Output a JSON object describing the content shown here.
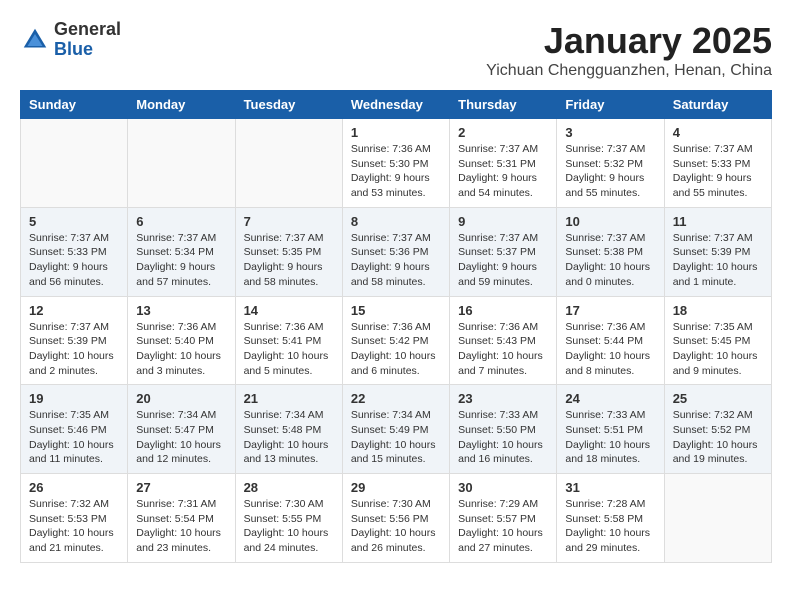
{
  "header": {
    "logo_general": "General",
    "logo_blue": "Blue",
    "month_title": "January 2025",
    "location": "Yichuan Chengguanzhen, Henan, China"
  },
  "weekdays": [
    "Sunday",
    "Monday",
    "Tuesday",
    "Wednesday",
    "Thursday",
    "Friday",
    "Saturday"
  ],
  "weeks": [
    [
      {
        "day": "",
        "sunrise": "",
        "sunset": "",
        "daylight": ""
      },
      {
        "day": "",
        "sunrise": "",
        "sunset": "",
        "daylight": ""
      },
      {
        "day": "",
        "sunrise": "",
        "sunset": "",
        "daylight": ""
      },
      {
        "day": "1",
        "sunrise": "Sunrise: 7:36 AM",
        "sunset": "Sunset: 5:30 PM",
        "daylight": "Daylight: 9 hours and 53 minutes."
      },
      {
        "day": "2",
        "sunrise": "Sunrise: 7:37 AM",
        "sunset": "Sunset: 5:31 PM",
        "daylight": "Daylight: 9 hours and 54 minutes."
      },
      {
        "day": "3",
        "sunrise": "Sunrise: 7:37 AM",
        "sunset": "Sunset: 5:32 PM",
        "daylight": "Daylight: 9 hours and 55 minutes."
      },
      {
        "day": "4",
        "sunrise": "Sunrise: 7:37 AM",
        "sunset": "Sunset: 5:33 PM",
        "daylight": "Daylight: 9 hours and 55 minutes."
      }
    ],
    [
      {
        "day": "5",
        "sunrise": "Sunrise: 7:37 AM",
        "sunset": "Sunset: 5:33 PM",
        "daylight": "Daylight: 9 hours and 56 minutes."
      },
      {
        "day": "6",
        "sunrise": "Sunrise: 7:37 AM",
        "sunset": "Sunset: 5:34 PM",
        "daylight": "Daylight: 9 hours and 57 minutes."
      },
      {
        "day": "7",
        "sunrise": "Sunrise: 7:37 AM",
        "sunset": "Sunset: 5:35 PM",
        "daylight": "Daylight: 9 hours and 58 minutes."
      },
      {
        "day": "8",
        "sunrise": "Sunrise: 7:37 AM",
        "sunset": "Sunset: 5:36 PM",
        "daylight": "Daylight: 9 hours and 58 minutes."
      },
      {
        "day": "9",
        "sunrise": "Sunrise: 7:37 AM",
        "sunset": "Sunset: 5:37 PM",
        "daylight": "Daylight: 9 hours and 59 minutes."
      },
      {
        "day": "10",
        "sunrise": "Sunrise: 7:37 AM",
        "sunset": "Sunset: 5:38 PM",
        "daylight": "Daylight: 10 hours and 0 minutes."
      },
      {
        "day": "11",
        "sunrise": "Sunrise: 7:37 AM",
        "sunset": "Sunset: 5:39 PM",
        "daylight": "Daylight: 10 hours and 1 minute."
      }
    ],
    [
      {
        "day": "12",
        "sunrise": "Sunrise: 7:37 AM",
        "sunset": "Sunset: 5:39 PM",
        "daylight": "Daylight: 10 hours and 2 minutes."
      },
      {
        "day": "13",
        "sunrise": "Sunrise: 7:36 AM",
        "sunset": "Sunset: 5:40 PM",
        "daylight": "Daylight: 10 hours and 3 minutes."
      },
      {
        "day": "14",
        "sunrise": "Sunrise: 7:36 AM",
        "sunset": "Sunset: 5:41 PM",
        "daylight": "Daylight: 10 hours and 5 minutes."
      },
      {
        "day": "15",
        "sunrise": "Sunrise: 7:36 AM",
        "sunset": "Sunset: 5:42 PM",
        "daylight": "Daylight: 10 hours and 6 minutes."
      },
      {
        "day": "16",
        "sunrise": "Sunrise: 7:36 AM",
        "sunset": "Sunset: 5:43 PM",
        "daylight": "Daylight: 10 hours and 7 minutes."
      },
      {
        "day": "17",
        "sunrise": "Sunrise: 7:36 AM",
        "sunset": "Sunset: 5:44 PM",
        "daylight": "Daylight: 10 hours and 8 minutes."
      },
      {
        "day": "18",
        "sunrise": "Sunrise: 7:35 AM",
        "sunset": "Sunset: 5:45 PM",
        "daylight": "Daylight: 10 hours and 9 minutes."
      }
    ],
    [
      {
        "day": "19",
        "sunrise": "Sunrise: 7:35 AM",
        "sunset": "Sunset: 5:46 PM",
        "daylight": "Daylight: 10 hours and 11 minutes."
      },
      {
        "day": "20",
        "sunrise": "Sunrise: 7:34 AM",
        "sunset": "Sunset: 5:47 PM",
        "daylight": "Daylight: 10 hours and 12 minutes."
      },
      {
        "day": "21",
        "sunrise": "Sunrise: 7:34 AM",
        "sunset": "Sunset: 5:48 PM",
        "daylight": "Daylight: 10 hours and 13 minutes."
      },
      {
        "day": "22",
        "sunrise": "Sunrise: 7:34 AM",
        "sunset": "Sunset: 5:49 PM",
        "daylight": "Daylight: 10 hours and 15 minutes."
      },
      {
        "day": "23",
        "sunrise": "Sunrise: 7:33 AM",
        "sunset": "Sunset: 5:50 PM",
        "daylight": "Daylight: 10 hours and 16 minutes."
      },
      {
        "day": "24",
        "sunrise": "Sunrise: 7:33 AM",
        "sunset": "Sunset: 5:51 PM",
        "daylight": "Daylight: 10 hours and 18 minutes."
      },
      {
        "day": "25",
        "sunrise": "Sunrise: 7:32 AM",
        "sunset": "Sunset: 5:52 PM",
        "daylight": "Daylight: 10 hours and 19 minutes."
      }
    ],
    [
      {
        "day": "26",
        "sunrise": "Sunrise: 7:32 AM",
        "sunset": "Sunset: 5:53 PM",
        "daylight": "Daylight: 10 hours and 21 minutes."
      },
      {
        "day": "27",
        "sunrise": "Sunrise: 7:31 AM",
        "sunset": "Sunset: 5:54 PM",
        "daylight": "Daylight: 10 hours and 23 minutes."
      },
      {
        "day": "28",
        "sunrise": "Sunrise: 7:30 AM",
        "sunset": "Sunset: 5:55 PM",
        "daylight": "Daylight: 10 hours and 24 minutes."
      },
      {
        "day": "29",
        "sunrise": "Sunrise: 7:30 AM",
        "sunset": "Sunset: 5:56 PM",
        "daylight": "Daylight: 10 hours and 26 minutes."
      },
      {
        "day": "30",
        "sunrise": "Sunrise: 7:29 AM",
        "sunset": "Sunset: 5:57 PM",
        "daylight": "Daylight: 10 hours and 27 minutes."
      },
      {
        "day": "31",
        "sunrise": "Sunrise: 7:28 AM",
        "sunset": "Sunset: 5:58 PM",
        "daylight": "Daylight: 10 hours and 29 minutes."
      },
      {
        "day": "",
        "sunrise": "",
        "sunset": "",
        "daylight": ""
      }
    ]
  ]
}
